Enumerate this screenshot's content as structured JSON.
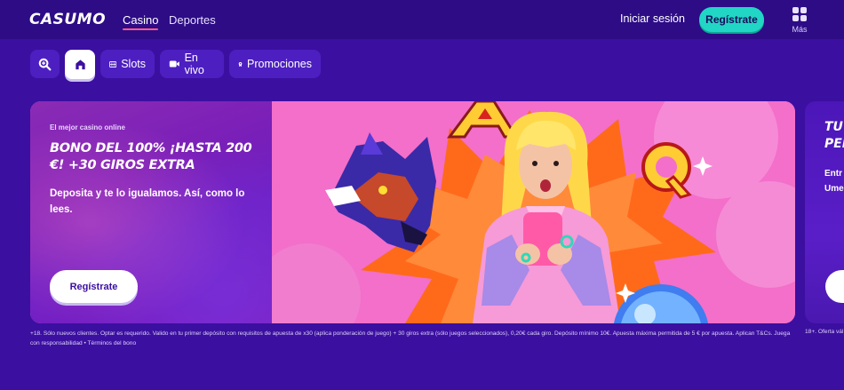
{
  "header": {
    "logo_text": "CASUMO",
    "nav": [
      {
        "label": "Casino",
        "active": true
      },
      {
        "label": "Deportes",
        "active": false
      }
    ],
    "login_label": "Iniciar sesión",
    "register_label": "Regístrate",
    "more_label": "Más"
  },
  "categories": [
    {
      "icon": "search-icon",
      "label": ""
    },
    {
      "icon": "home-icon",
      "label": "",
      "active": true
    },
    {
      "icon": "slot-machine-icon",
      "label": "Slots"
    },
    {
      "icon": "video-camera-icon",
      "label": "En vivo"
    },
    {
      "icon": "badge-icon",
      "label": "Promociones"
    }
  ],
  "banner": {
    "eyebrow": "El mejor casino online",
    "title": "BONO DEL 100% ¡HASTA 200 €! +30 GIROS EXTRA",
    "subtitle": "Deposita y te lo igualamos. Así, como lo lees.",
    "cta_label": "Regístrate",
    "terms": "+18. Sólo nuevos clientes. Optar es requerido. Valido en tu primer depósito con requisitos de apuesta de x30 (aplica ponderación de juego) + 30 giros extra (sólo juegos seleccionados), 0,20€ cada giro. Depósito mínimo 10€. Apuesta máxima permitida de 5 € por apuesta. Aplican T&Cs. Juega con responsabilidad • Términos del bono"
  },
  "next_banner": {
    "title_line1": "TU",
    "title_line2": "PER",
    "sub_line1": "Entr",
    "sub_line2": "Ume",
    "terms": "18+. Oferta vál"
  },
  "colors": {
    "background": "#3b0fa0",
    "header": "#2d0c86",
    "accent_teal": "#21d6c4",
    "banner_pink": "#f06ec9"
  }
}
